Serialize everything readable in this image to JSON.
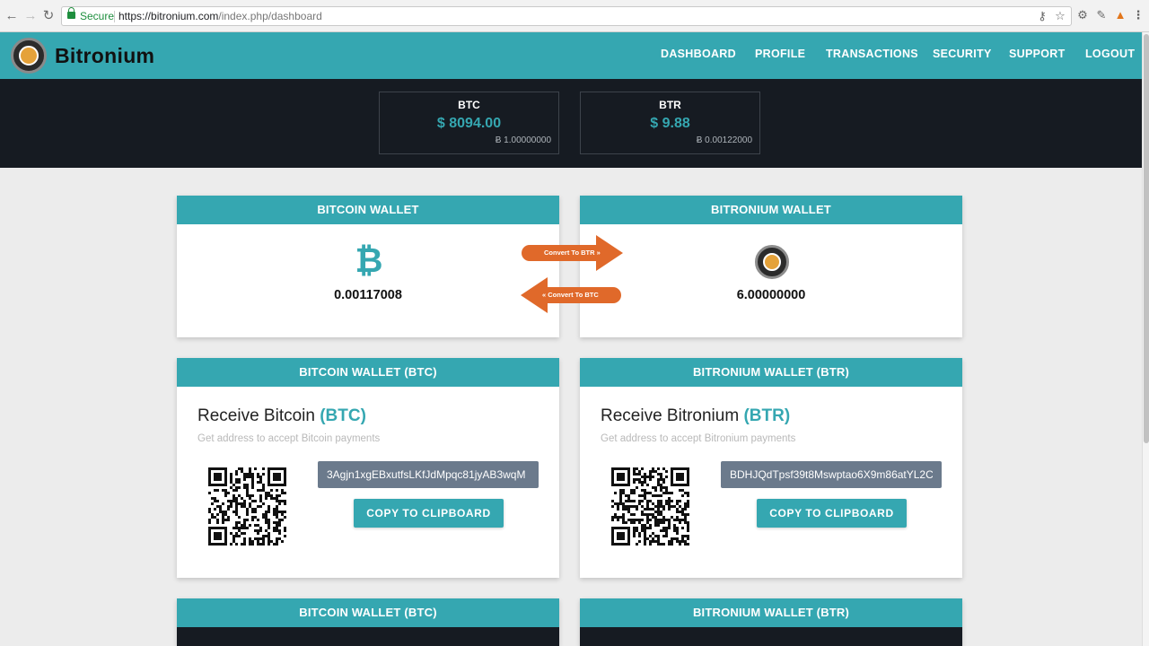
{
  "browser": {
    "secure_label": "Secure",
    "url_domain": "https://bitronium.com",
    "url_path": "/index.php/dashboard"
  },
  "site": {
    "name": "Bitronium",
    "nav": [
      "DASHBOARD",
      "PROFILE",
      "TRANSACTIONS",
      "SECURITY",
      "SUPPORT",
      "LOGOUT"
    ]
  },
  "prices": [
    {
      "symbol": "BTC",
      "usd": "$ 8094.00",
      "sub": "Ƀ 1.00000000"
    },
    {
      "symbol": "BTR",
      "usd": "$ 9.88",
      "sub": "Ƀ 0.00122000"
    }
  ],
  "wallets": {
    "bitcoin": {
      "title": "BITCOIN WALLET",
      "balance": "0.00117008"
    },
    "bitronium": {
      "title": "BITRONIUM WALLET",
      "balance": "6.00000000"
    },
    "convert_to_btr": "Convert To BTR »",
    "convert_to_btc": "« Convert To BTC"
  },
  "receive": {
    "btc": {
      "header": "BITCOIN WALLET (BTC)",
      "title_prefix": "Receive Bitcoin",
      "title_currency": "(BTC)",
      "subtitle": "Get address to accept Bitcoin payments",
      "address": "3Agjn1xgEBxutfsLKfJdMpqc81jyAB3wqM",
      "copy_label": "COPY TO CLIPBOARD"
    },
    "btr": {
      "header": "BITRONIUM WALLET (BTR)",
      "title_prefix": "Receive Bitronium",
      "title_currency": "(BTR)",
      "subtitle": "Get address to accept Bitronium payments",
      "address": "BDHJQdTpsf39t8Mswptao6X9m86atYL2C",
      "copy_label": "COPY TO CLIPBOARD"
    }
  },
  "bottom": {
    "btc_header": "BITCOIN WALLET (BTC)",
    "btr_header": "BITRONIUM WALLET (BTR)"
  },
  "colors": {
    "brand": "#35a7b1",
    "dark": "#161b22",
    "arrow": "#e0692a",
    "address_bg": "#6b7a8c"
  }
}
